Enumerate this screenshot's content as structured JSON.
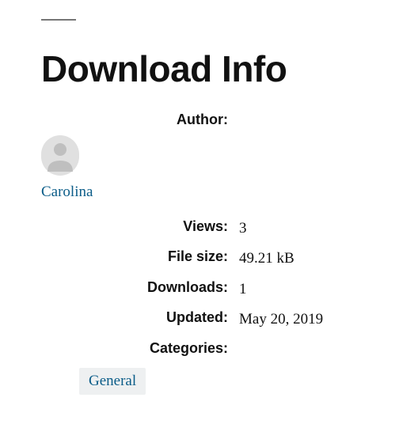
{
  "title": "Download Info",
  "labels": {
    "author": "Author:",
    "views": "Views:",
    "file_size": "File size:",
    "downloads": "Downloads:",
    "updated": "Updated:",
    "categories": "Categories:"
  },
  "values": {
    "author_name": "Carolina",
    "views": "3",
    "file_size": "49.21 kB",
    "downloads": "1",
    "updated": "May 20, 2019"
  },
  "categories": {
    "tag1": "General"
  }
}
